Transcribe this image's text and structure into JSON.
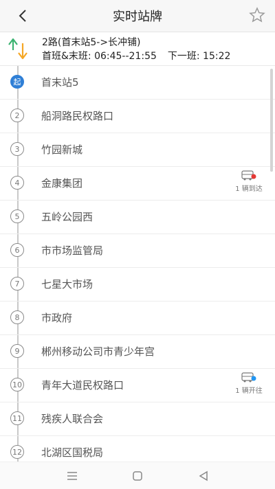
{
  "header": {
    "title": "实时站牌"
  },
  "route": {
    "name": "2路(首末站5->长冲铺)",
    "times": "首班&末班: 06:45--21:55",
    "next": "下一班: 15:22"
  },
  "stops": [
    {
      "num": "起",
      "name": "首末站5",
      "start": true
    },
    {
      "num": "2",
      "name": "船洞路民权路口"
    },
    {
      "num": "3",
      "name": "竹园新城"
    },
    {
      "num": "4",
      "name": "金康集团",
      "bus": {
        "label": "1 辆到达",
        "status": "arrived"
      }
    },
    {
      "num": "5",
      "name": "五岭公园西"
    },
    {
      "num": "6",
      "name": "市市场监管局"
    },
    {
      "num": "7",
      "name": "七星大市场"
    },
    {
      "num": "8",
      "name": "市政府"
    },
    {
      "num": "9",
      "name": "郴州移动公司市青少年宫"
    },
    {
      "num": "10",
      "name": "青年大道民权路口",
      "bus": {
        "label": "1 辆开往",
        "status": "enroute"
      }
    },
    {
      "num": "11",
      "name": "残疾人联合会"
    },
    {
      "num": "12",
      "name": "北湖区国税局"
    }
  ],
  "colors": {
    "accent": "#2f7fd6",
    "arrived": "#e53935",
    "enroute": "#2196f3",
    "route_icon_up": "#3cb371",
    "route_icon_down": "#f5a623"
  }
}
